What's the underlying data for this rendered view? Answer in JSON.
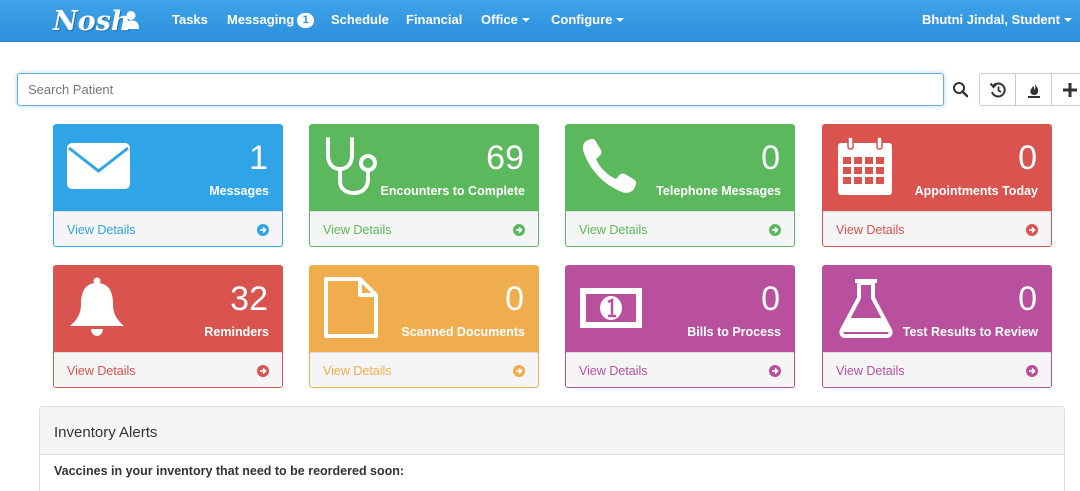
{
  "navbar": {
    "brand": "Nosh",
    "items": [
      {
        "label": "Tasks"
      },
      {
        "label": "Messaging",
        "badge": "1"
      },
      {
        "label": "Schedule"
      },
      {
        "label": "Financial"
      },
      {
        "label": "Office"
      },
      {
        "label": "Configure"
      }
    ],
    "user": "Bhutni Jindal, Student"
  },
  "search": {
    "placeholder": "Search Patient",
    "value": ""
  },
  "panels": [
    {
      "count": "1",
      "label": "Messages",
      "link": "View Details",
      "icon": "envelope-icon",
      "color": "#2fa4e7"
    },
    {
      "count": "69",
      "label": "Encounters to Complete",
      "link": "View Details",
      "icon": "stethoscope-icon",
      "color": "#5cb85c"
    },
    {
      "count": "0",
      "label": "Telephone Messages",
      "link": "View Details",
      "icon": "phone-icon",
      "color": "#5cb85c"
    },
    {
      "count": "0",
      "label": "Appointments Today",
      "link": "View Details",
      "icon": "calendar-icon",
      "color": "#d9534f"
    },
    {
      "count": "32",
      "label": "Reminders",
      "link": "View Details",
      "icon": "bell-icon",
      "color": "#d9534f"
    },
    {
      "count": "0",
      "label": "Scanned Documents",
      "link": "View Details",
      "icon": "document-icon",
      "color": "#f0ad4e"
    },
    {
      "count": "0",
      "label": "Bills to Process",
      "link": "View Details",
      "icon": "money-bill-icon",
      "color": "#b9509d"
    },
    {
      "count": "0",
      "label": "Test Results to Review",
      "link": "View Details",
      "icon": "flask-icon",
      "color": "#b9509d"
    }
  ],
  "inventory": {
    "title": "Inventory Alerts",
    "text": "Vaccines in your inventory that need to be reordered soon:"
  }
}
